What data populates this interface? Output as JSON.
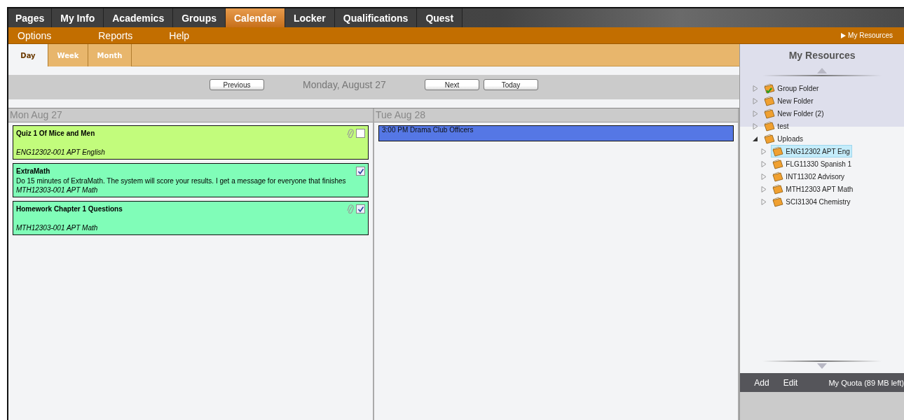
{
  "nav_tabs": [
    {
      "label": "Pages",
      "selected": false
    },
    {
      "label": "My Info",
      "selected": false
    },
    {
      "label": "Academics",
      "selected": false
    },
    {
      "label": "Groups",
      "selected": false
    },
    {
      "label": "Calendar",
      "selected": true
    },
    {
      "label": "Locker",
      "selected": false
    },
    {
      "label": "Qualifications",
      "selected": false
    },
    {
      "label": "Quest",
      "selected": false
    }
  ],
  "menu": [
    "Options",
    "Reports",
    "Help"
  ],
  "resources_link": "My Resources",
  "view_tabs": [
    {
      "label": "Day",
      "selected": true
    },
    {
      "label": "Week",
      "selected": false
    },
    {
      "label": "Month",
      "selected": false
    }
  ],
  "toolbar": {
    "previous": "Previous",
    "date": "Monday, August 27",
    "next": "Next",
    "today": "Today"
  },
  "days": [
    {
      "header": "Mon Aug 27",
      "events": [
        {
          "kind": "task",
          "title": "Quiz 1 Of Mice and Men",
          "course": "ENG12302-001 APT English",
          "color": "#c2fc7c",
          "attachment": true,
          "checked": false
        },
        {
          "kind": "task",
          "title": "ExtraMath",
          "description": "Do 15 minutes of ExtraMath. The system will score your results. I get a message for everyone that finishes",
          "course": "MTH12303-001 APT Math",
          "color": "#80fdb8",
          "attachment": false,
          "checked": true
        },
        {
          "kind": "task",
          "title": "Homework Chapter 1 Questions",
          "course": "MTH12303-001 APT Math",
          "color": "#80fdb8",
          "attachment": true,
          "checked": true
        }
      ]
    },
    {
      "header": "Tue Aug 28",
      "events": [
        {
          "kind": "event",
          "title": "3:00 PM Drama Club Officers",
          "color": "#5577e5"
        }
      ]
    }
  ],
  "resources": {
    "title": "My Resources",
    "items": [
      {
        "label": "Group Folder",
        "shared": true,
        "expanded": false,
        "selected": false
      },
      {
        "label": "New Folder",
        "shared": false,
        "expanded": false,
        "selected": false
      },
      {
        "label": "New Folder (2)",
        "shared": false,
        "expanded": false,
        "selected": false
      },
      {
        "label": "test",
        "shared": false,
        "expanded": false,
        "selected": false
      },
      {
        "label": "Uploads",
        "shared": false,
        "expanded": true,
        "selected": false,
        "children": [
          {
            "label": "ENG12302 APT Eng",
            "shared": false,
            "expanded": false,
            "selected": true
          },
          {
            "label": "FLG11330 Spanish 1",
            "shared": false,
            "expanded": false,
            "selected": false
          },
          {
            "label": "INT11302 Advisory",
            "shared": false,
            "expanded": false,
            "selected": false
          },
          {
            "label": "MTH12303 APT Math",
            "shared": false,
            "expanded": false,
            "selected": false
          },
          {
            "label": "SCI31304 Chemistry",
            "shared": false,
            "expanded": false,
            "selected": false
          }
        ]
      }
    ],
    "actions": [
      "Add",
      "Edit"
    ],
    "quota": "My Quota (89 MB left)"
  }
}
